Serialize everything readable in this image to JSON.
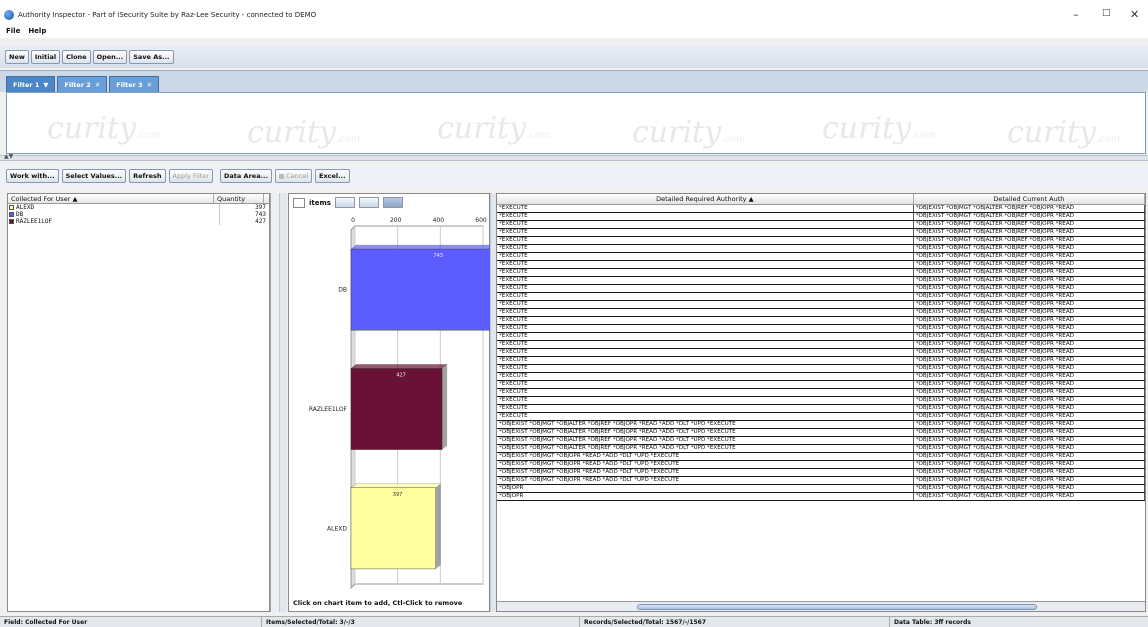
{
  "window": {
    "title": "Authority Inspector - Part of iSecurity Suite by Raz-Lee Security - connected to DEMO"
  },
  "menu": [
    "File",
    "Help"
  ],
  "toolbar": [
    "New",
    "Initial",
    "Clone",
    "Open...",
    "Save As..."
  ],
  "tabs": [
    {
      "label": "Filter 1"
    },
    {
      "label": "Filter 2"
    },
    {
      "label": "Filter 3"
    }
  ],
  "watermark": {
    "text": "curity",
    "sub": ".com"
  },
  "toolbar2": {
    "work_with": "Work with...",
    "select_values": "Select Values...",
    "refresh": "Refresh",
    "apply_filter": "Apply Filter",
    "data_area": "Data Area...",
    "cancel": "Cancel",
    "excel": "Excel..."
  },
  "left_table": {
    "headers": [
      "Collected For User ▲",
      "Quantity"
    ],
    "rows": [
      {
        "user": "ALEXD",
        "qty": "397",
        "color": "#ffffa0"
      },
      {
        "user": "DB",
        "qty": "743",
        "color": "#5d5dff"
      },
      {
        "user": "RAZLEE1LOF",
        "qty": "427",
        "color": "#6a1136"
      }
    ]
  },
  "chart_toolbar": {
    "items_label": "items",
    "items_value": ""
  },
  "chart_hint": "Click on chart item to add, Ctl-Click to remove",
  "chart_data": {
    "type": "bar",
    "orientation": "horizontal",
    "categories": [
      "DB",
      "RAZLEE1LOF",
      "ALEXD"
    ],
    "values": [
      743,
      427,
      397
    ],
    "colors": [
      "#5d5dff",
      "#6a1136",
      "#ffffa0"
    ],
    "xticks": [
      0,
      200,
      400,
      600
    ],
    "grid": true
  },
  "right_table": {
    "headers": [
      "Detailed Required Authority ▲",
      "Detailed Current Auth"
    ],
    "rows": [
      [
        "*EXECUTE",
        "*OBJEXIST *OBJMGT *OBJALTER *OBJREF *OBJOPR *READ"
      ],
      [
        "*EXECUTE",
        "*OBJEXIST *OBJMGT *OBJALTER *OBJREF *OBJOPR *READ"
      ],
      [
        "*EXECUTE",
        "*OBJEXIST *OBJMGT *OBJALTER *OBJREF *OBJOPR *READ"
      ],
      [
        "*EXECUTE",
        "*OBJEXIST *OBJMGT *OBJALTER *OBJREF *OBJOPR *READ"
      ],
      [
        "*EXECUTE",
        "*OBJEXIST *OBJMGT *OBJALTER *OBJREF *OBJOPR *READ"
      ],
      [
        "*EXECUTE",
        "*OBJEXIST *OBJMGT *OBJALTER *OBJREF *OBJOPR *READ"
      ],
      [
        "*EXECUTE",
        "*OBJEXIST *OBJMGT *OBJALTER *OBJREF *OBJOPR *READ"
      ],
      [
        "*EXECUTE",
        "*OBJEXIST *OBJMGT *OBJALTER *OBJREF *OBJOPR *READ"
      ],
      [
        "*EXECUTE",
        "*OBJEXIST *OBJMGT *OBJALTER *OBJREF *OBJOPR *READ"
      ],
      [
        "*EXECUTE",
        "*OBJEXIST *OBJMGT *OBJALTER *OBJREF *OBJOPR *READ"
      ],
      [
        "*EXECUTE",
        "*OBJEXIST *OBJMGT *OBJALTER *OBJREF *OBJOPR *READ"
      ],
      [
        "*EXECUTE",
        "*OBJEXIST *OBJMGT *OBJALTER *OBJREF *OBJOPR *READ"
      ],
      [
        "*EXECUTE",
        "*OBJEXIST *OBJMGT *OBJALTER *OBJREF *OBJOPR *READ"
      ],
      [
        "*EXECUTE",
        "*OBJEXIST *OBJMGT *OBJALTER *OBJREF *OBJOPR *READ"
      ],
      [
        "*EXECUTE",
        "*OBJEXIST *OBJMGT *OBJALTER *OBJREF *OBJOPR *READ"
      ],
      [
        "*EXECUTE",
        "*OBJEXIST *OBJMGT *OBJALTER *OBJREF *OBJOPR *READ"
      ],
      [
        "*EXECUTE",
        "*OBJEXIST *OBJMGT *OBJALTER *OBJREF *OBJOPR *READ"
      ],
      [
        "*EXECUTE",
        "*OBJEXIST *OBJMGT *OBJALTER *OBJREF *OBJOPR *READ"
      ],
      [
        "*EXECUTE",
        "*OBJEXIST *OBJMGT *OBJALTER *OBJREF *OBJOPR *READ"
      ],
      [
        "*EXECUTE",
        "*OBJEXIST *OBJMGT *OBJALTER *OBJREF *OBJOPR *READ"
      ],
      [
        "*EXECUTE",
        "*OBJEXIST *OBJMGT *OBJALTER *OBJREF *OBJOPR *READ"
      ],
      [
        "*EXECUTE",
        "*OBJEXIST *OBJMGT *OBJALTER *OBJREF *OBJOPR *READ"
      ],
      [
        "*EXECUTE",
        "*OBJEXIST *OBJMGT *OBJALTER *OBJREF *OBJOPR *READ"
      ],
      [
        "*EXECUTE",
        "*OBJEXIST *OBJMGT *OBJALTER *OBJREF *OBJOPR *READ"
      ],
      [
        "*EXECUTE",
        "*OBJEXIST *OBJMGT *OBJALTER *OBJREF *OBJOPR *READ"
      ],
      [
        "*EXECUTE",
        "*OBJEXIST *OBJMGT *OBJALTER *OBJREF *OBJOPR *READ"
      ],
      [
        "*EXECUTE",
        "*OBJEXIST *OBJMGT *OBJALTER *OBJREF *OBJOPR *READ"
      ],
      [
        "*OBJEXIST *OBJMGT *OBJALTER *OBJREF *OBJOPR *READ *ADD *DLT *UPD *EXECUTE",
        "*OBJEXIST *OBJMGT *OBJALTER *OBJREF *OBJOPR *READ"
      ],
      [
        "*OBJEXIST *OBJMGT *OBJALTER *OBJREF *OBJOPR *READ *ADD *DLT *UPD *EXECUTE",
        "*OBJEXIST *OBJMGT *OBJALTER *OBJREF *OBJOPR *READ"
      ],
      [
        "*OBJEXIST *OBJMGT *OBJALTER *OBJREF *OBJOPR *READ *ADD *DLT *UPD *EXECUTE",
        "*OBJEXIST *OBJMGT *OBJALTER *OBJREF *OBJOPR *READ"
      ],
      [
        "*OBJEXIST *OBJMGT *OBJALTER *OBJREF *OBJOPR *READ *ADD *DLT *UPD *EXECUTE",
        "*OBJEXIST *OBJMGT *OBJALTER *OBJREF *OBJOPR *READ"
      ],
      [
        "*OBJEXIST *OBJMGT *OBJOPR *READ *ADD *DLT *UPD *EXECUTE",
        "*OBJEXIST *OBJMGT *OBJALTER *OBJREF *OBJOPR *READ"
      ],
      [
        "*OBJEXIST *OBJMGT *OBJOPR *READ *ADD *DLT *UPD *EXECUTE",
        "*OBJEXIST *OBJMGT *OBJALTER *OBJREF *OBJOPR *READ"
      ],
      [
        "*OBJEXIST *OBJMGT *OBJOPR *READ *ADD *DLT *UPD *EXECUTE",
        "*OBJEXIST *OBJMGT *OBJALTER *OBJREF *OBJOPR *READ"
      ],
      [
        "*OBJEXIST *OBJMGT *OBJOPR *READ *ADD *DLT *UPD *EXECUTE",
        "*OBJEXIST *OBJMGT *OBJALTER *OBJREF *OBJOPR *READ"
      ],
      [
        "*OBJOPR",
        "*OBJEXIST *OBJMGT *OBJALTER *OBJREF *OBJOPR *READ"
      ],
      [
        "*OBJOPR",
        "*OBJEXIST *OBJMGT *OBJALTER *OBJREF *OBJOPR *READ"
      ]
    ]
  },
  "status": [
    "Field: Collected For User",
    "Items/Selected/Total: 3/-/3",
    "Records/Selected/Total: 1567/-/1567",
    "Data Table: 3ff records"
  ]
}
